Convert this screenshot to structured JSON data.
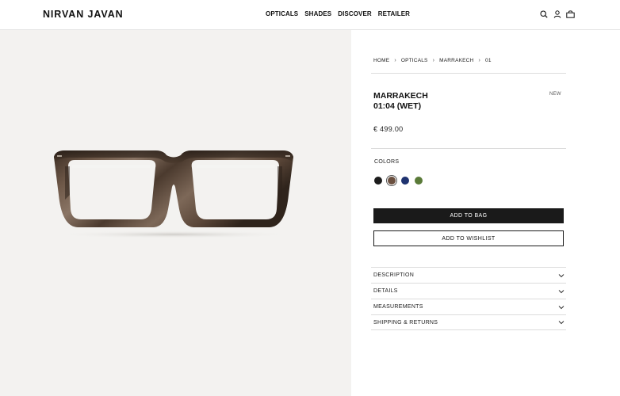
{
  "header": {
    "logo": "NIRVAN JAVAN",
    "nav": [
      "OPTICALS",
      "SHADES",
      "DISCOVER",
      "RETAILER"
    ],
    "icons": [
      "search-icon",
      "account-icon",
      "bag-icon"
    ]
  },
  "breadcrumb": [
    "HOME",
    "OPTICALS",
    "MARRAKECH",
    "01"
  ],
  "product": {
    "title_line1": "MARRAKECH",
    "title_line2": "01:04 (WET)",
    "badge": "NEW",
    "price": "€ 499.00",
    "colors_label": "COLORS",
    "colors": [
      {
        "name": "black",
        "hex": "#1c1c1c",
        "selected": false
      },
      {
        "name": "tortoise",
        "hex": "#6b5040",
        "selected": true
      },
      {
        "name": "navy",
        "hex": "#1f3370",
        "selected": false
      },
      {
        "name": "olive",
        "hex": "#5a7a38",
        "selected": false
      }
    ],
    "add_to_bag": "ADD TO BAG",
    "add_to_wishlist": "ADD TO WISHLIST"
  },
  "accordion": [
    "DESCRIPTION",
    "DETAILS",
    "MEASUREMENTS",
    "SHIPPING & RETURNS"
  ],
  "colors": {
    "image_bg": "#f3f2f0",
    "button_dark": "#1a1a1a"
  }
}
